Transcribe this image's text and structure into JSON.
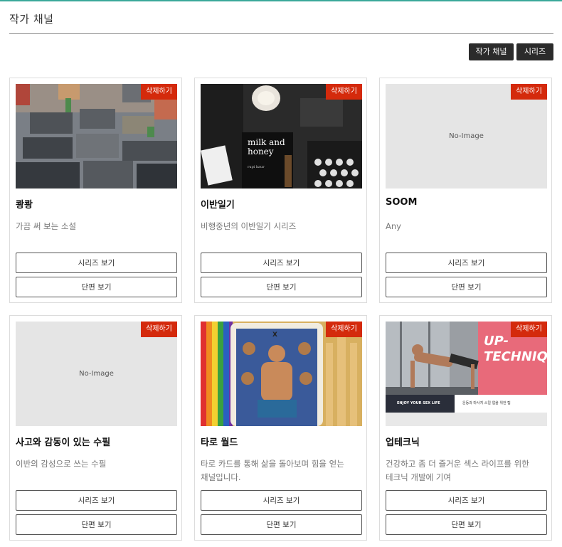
{
  "header": {
    "title": "작가 채널",
    "buttons": {
      "channel": "작가 채널",
      "series": "시리즈"
    }
  },
  "labels": {
    "delete": "삭제하기",
    "view_series": "시리즈 보기",
    "view_single": "단편 보기",
    "no_image": "No-Image"
  },
  "cards": [
    {
      "title": "쾅쾅",
      "desc": "가끔 써 보는 소설",
      "image": "city-rooftops"
    },
    {
      "title": "이반일기",
      "desc": "비행중년의 이반일기 시리즈",
      "image": "milk-and-honey",
      "image_text": {
        "book_title": "milk and honey",
        "book_author": "rupi kaur"
      }
    },
    {
      "title": "SOOM",
      "desc": "Any",
      "image": "none"
    },
    {
      "title": "사고와 감동이 있는 수필",
      "desc": "이반의 감성으로 쓰는 수필",
      "image": "none"
    },
    {
      "title": "타로 월드",
      "desc": "타로 카드를 통해 삶을 돌아보며 힘을 얻는 채널입니다.",
      "image": "tarot-card",
      "image_text": {
        "numeral": "X"
      }
    },
    {
      "title": "업테크닉",
      "desc": "건강하고 좀 더 즐거운 섹스 라이프를 위한 테크닉 개발에 기여",
      "image": "up-technique",
      "image_text": {
        "headline1": "UP-",
        "headline2": "TECHNIQUE",
        "tagline": "ENJOY YOUR SEX LIFE",
        "subtext": "운동과 마사지 스킬 업을 위한 팁"
      }
    }
  ]
}
